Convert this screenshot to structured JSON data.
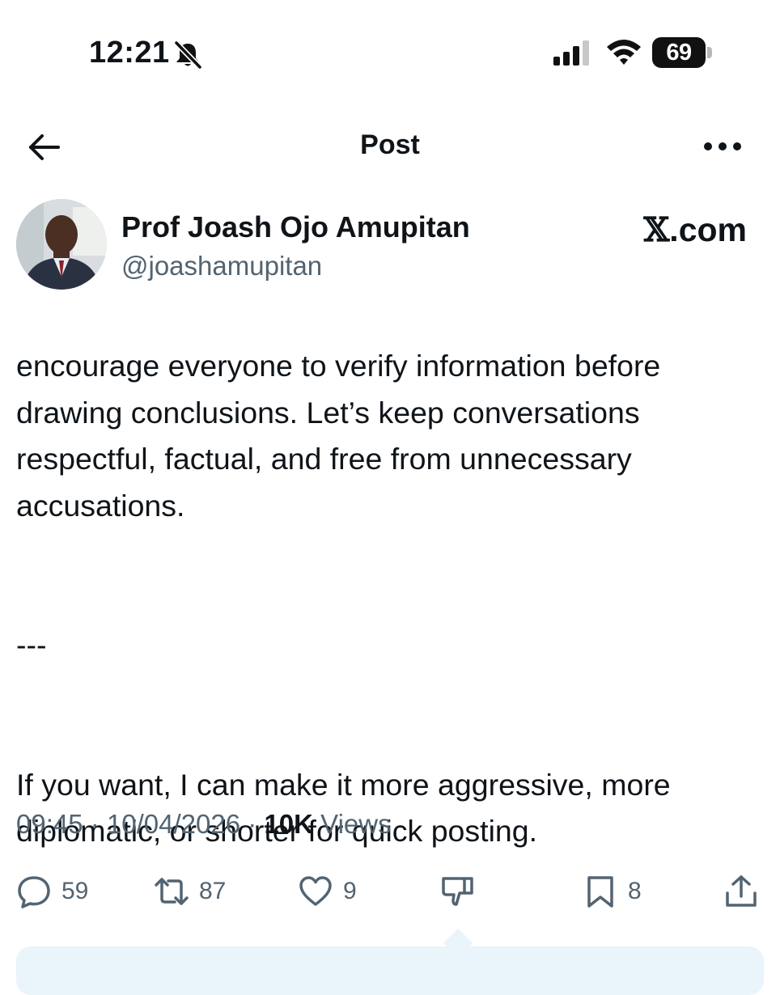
{
  "status_bar": {
    "time": "12:21",
    "battery_level": "69",
    "icons": [
      "bell-slash-icon",
      "cellular-signal-icon",
      "wifi-icon",
      "battery-icon"
    ]
  },
  "header": {
    "title": "Post",
    "back_icon": "arrow-left-icon",
    "more_icon": "ellipsis-icon"
  },
  "author": {
    "name": "Prof Joash Ojo Amupitan",
    "handle": "@joashamupitan"
  },
  "watermark": {
    "x_glyph": "𝕏",
    "domain": ".com"
  },
  "post": {
    "text": "encourage everyone to verify information before drawing conclusions. Let’s keep conversations respectful, factual, and free from unnecessary accusations.\n\n\n---\n\n\nIf you want, I can make it more aggressive, more diplomatic, or shorter for quick posting."
  },
  "meta": {
    "time": "09:45",
    "separator": "·",
    "date": "10/04/2026",
    "views_count": "10K",
    "views_label": "Views"
  },
  "actions": {
    "replies": "59",
    "reposts": "87",
    "likes": "9",
    "bookmarks": "8"
  },
  "colors": {
    "text_primary": "#0f1419",
    "text_secondary": "#536471",
    "reply_box_bg": "#e9f4fb"
  }
}
